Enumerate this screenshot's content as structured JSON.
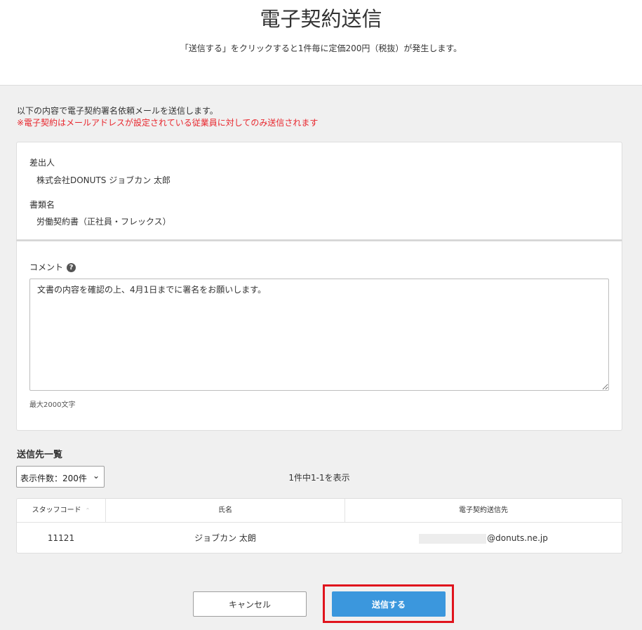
{
  "header": {
    "title": "電子契約送信",
    "subtitle": "「送信する」をクリックすると1件毎に定価200円（税抜）が発生します。"
  },
  "intro": {
    "line1": "以下の内容で電子契約署名依頼メールを送信します。",
    "warning": "※電子契約はメールアドレスが設定されている従業員に対してのみ送信されます"
  },
  "sender": {
    "label": "差出人",
    "value": "株式会社DONUTS ジョブカン 太郎"
  },
  "document": {
    "label": "書類名",
    "value": "労働契約書（正社員・フレックス）"
  },
  "comment": {
    "label": "コメント",
    "help_icon": "?",
    "value": "文書の内容を確認の上、4月1日までに署名をお願いします。",
    "limit": "最大2000文字"
  },
  "recipients": {
    "title": "送信先一覧",
    "page_size": "表示件数：200件",
    "page_size_caret": "⌄",
    "count_text": "1件中1-1を表示",
    "columns": [
      "スタッフコード",
      "氏名",
      "電子契約送信先"
    ],
    "sort_icon": "⌃",
    "rows": [
      {
        "code": "11121",
        "name": "ジョブカン 太朗",
        "email_suffix": "@donuts.ne.jp"
      }
    ]
  },
  "buttons": {
    "cancel": "キャンセル",
    "send": "送信する"
  },
  "colors": {
    "accent": "#3b97dd",
    "warning": "#e8262d",
    "highlight": "#e0141d"
  }
}
